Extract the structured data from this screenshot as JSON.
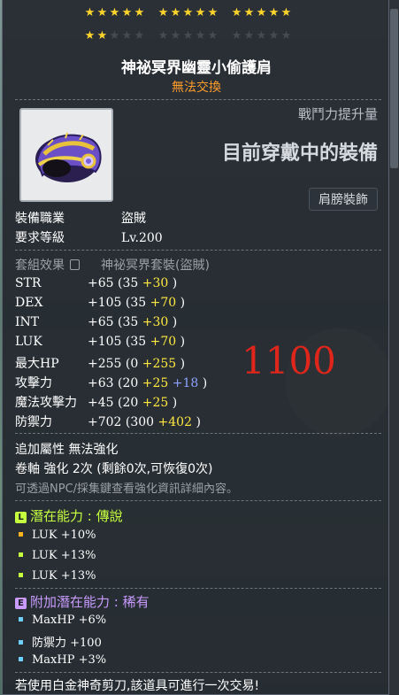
{
  "stars": {
    "row1": [
      5,
      5,
      5
    ],
    "row2_filled": 2,
    "row2_total": 15
  },
  "item": {
    "name": "神祕冥界幽靈小偷護肩",
    "trade_status": "無法交換",
    "cp_label": "戰鬥力提升量",
    "cp_value": "目前穿戴中的裝備",
    "category": "肩膀裝飾"
  },
  "requirements": {
    "job_label": "裝備職業",
    "job_value": "盜賊",
    "level_label": "要求等級",
    "level_value": "Lv.200"
  },
  "set": {
    "label": "套組效果",
    "value": "神祕冥界套裝(盜賊)"
  },
  "stats": [
    {
      "name": "STR",
      "total": "+65",
      "base": "(35",
      "bonus": "+30",
      "extra": "",
      "close": ")"
    },
    {
      "name": "DEX",
      "total": "+105",
      "base": "(35",
      "bonus": "+70",
      "extra": "",
      "close": ")"
    },
    {
      "name": "INT",
      "total": "+65",
      "base": "(35",
      "bonus": "+30",
      "extra": "",
      "close": ")"
    },
    {
      "name": "LUK",
      "total": "+105",
      "base": "(35",
      "bonus": "+70",
      "extra": "",
      "close": ")"
    },
    {
      "name": "最大HP",
      "total": "+255",
      "base": "(0",
      "bonus": "+255",
      "extra": "",
      "close": ")"
    },
    {
      "name": "攻擊力",
      "total": "+63",
      "base": "(20",
      "bonus": "+25",
      "extra": "+18",
      "close": ")"
    },
    {
      "name": "魔法攻擊力",
      "total": "+45",
      "base": "(20",
      "bonus": "+25",
      "extra": "",
      "close": ")"
    },
    {
      "name": "防禦力",
      "total": "+702",
      "base": "(300",
      "bonus": "+402",
      "extra": "",
      "close": ")"
    }
  ],
  "overlay_number": "1100",
  "extra_info": {
    "bonus_line": "追加屬性 無法強化",
    "scroll_line": "卷軸 強化 2次 (剩餘0次,可恢復0次)",
    "hint_line": "可透過NPC/採集鍵查看強化資訊詳細內容。"
  },
  "potential": {
    "badge": "L",
    "title": "潛在能力 : 傳說",
    "color": "#c6ff3e",
    "lines": [
      "LUK +10%",
      "LUK +13%",
      "LUK +13%"
    ],
    "dot_colors": [
      "#ffb31e",
      "#c6ff3e",
      "#c6ff3e"
    ]
  },
  "additional_potential": {
    "badge": "E",
    "title": "附加潛在能力 : 稀有",
    "color": "#c99bff",
    "lines": [
      "MaxHP +6%",
      "防禦力 +100",
      "MaxHP +3%"
    ],
    "dot_colors": [
      "#6fd0ff",
      "#6fd0ff",
      "#6fd0ff"
    ]
  },
  "footer": "若使用白金神奇剪刀,該道具可進行一次交易!"
}
